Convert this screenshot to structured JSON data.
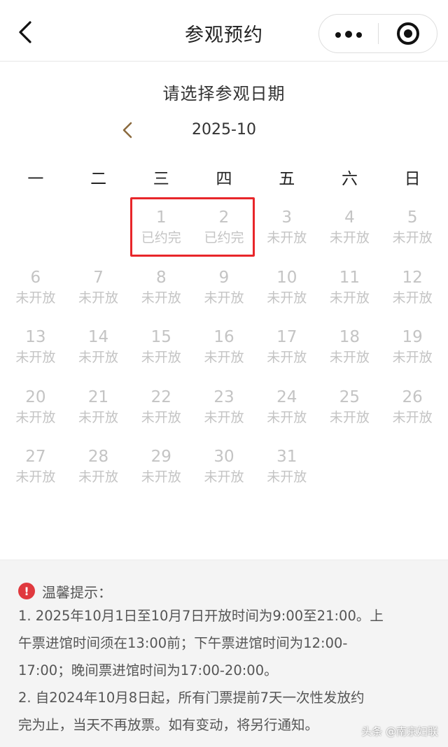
{
  "nav": {
    "title": "参观预约"
  },
  "heading": "请选择参观日期",
  "month_label": "2025-10",
  "weekdays": [
    "一",
    "二",
    "三",
    "四",
    "五",
    "六",
    "日"
  ],
  "days": [
    {
      "num": "",
      "status": ""
    },
    {
      "num": "",
      "status": ""
    },
    {
      "num": "1",
      "status": "已约完"
    },
    {
      "num": "2",
      "status": "已约完"
    },
    {
      "num": "3",
      "status": "未开放"
    },
    {
      "num": "4",
      "status": "未开放"
    },
    {
      "num": "5",
      "status": "未开放"
    },
    {
      "num": "6",
      "status": "未开放"
    },
    {
      "num": "7",
      "status": "未开放"
    },
    {
      "num": "8",
      "status": "未开放"
    },
    {
      "num": "9",
      "status": "未开放"
    },
    {
      "num": "10",
      "status": "未开放"
    },
    {
      "num": "11",
      "status": "未开放"
    },
    {
      "num": "12",
      "status": "未开放"
    },
    {
      "num": "13",
      "status": "未开放"
    },
    {
      "num": "14",
      "status": "未开放"
    },
    {
      "num": "15",
      "status": "未开放"
    },
    {
      "num": "16",
      "status": "未开放"
    },
    {
      "num": "17",
      "status": "未开放"
    },
    {
      "num": "18",
      "status": "未开放"
    },
    {
      "num": "19",
      "status": "未开放"
    },
    {
      "num": "20",
      "status": "未开放"
    },
    {
      "num": "21",
      "status": "未开放"
    },
    {
      "num": "22",
      "status": "未开放"
    },
    {
      "num": "23",
      "status": "未开放"
    },
    {
      "num": "24",
      "status": "未开放"
    },
    {
      "num": "25",
      "status": "未开放"
    },
    {
      "num": "26",
      "status": "未开放"
    },
    {
      "num": "27",
      "status": "未开放"
    },
    {
      "num": "28",
      "status": "未开放"
    },
    {
      "num": "29",
      "status": "未开放"
    },
    {
      "num": "30",
      "status": "未开放"
    },
    {
      "num": "31",
      "status": "未开放"
    }
  ],
  "notice": {
    "title": "温馨提示：",
    "lines": [
      "1. 2025年10月1日至10月7日开放时间为9:00至21:00。上",
      "午票进馆时间须在13:00前；下午票进馆时间为12:00-",
      "17:00；晚间票进馆时间为17:00-20:00。",
      "2. 自2024年10月8日起，所有门票提前7天一次性发放约",
      "完为止，当天不再放票。如有变动，将另行通知。"
    ]
  },
  "watermark": "头条 @南京妇联",
  "colors": {
    "accent": "#8b6a3e",
    "highlight": "#e8262a",
    "disabled": "#c4c4c4",
    "warning": "#e0393e"
  },
  "icons": {
    "back": "chevron-left-icon",
    "more": "more-dots-icon",
    "close": "target-close-icon",
    "prev": "chevron-left-icon",
    "warning": "exclamation-icon"
  }
}
